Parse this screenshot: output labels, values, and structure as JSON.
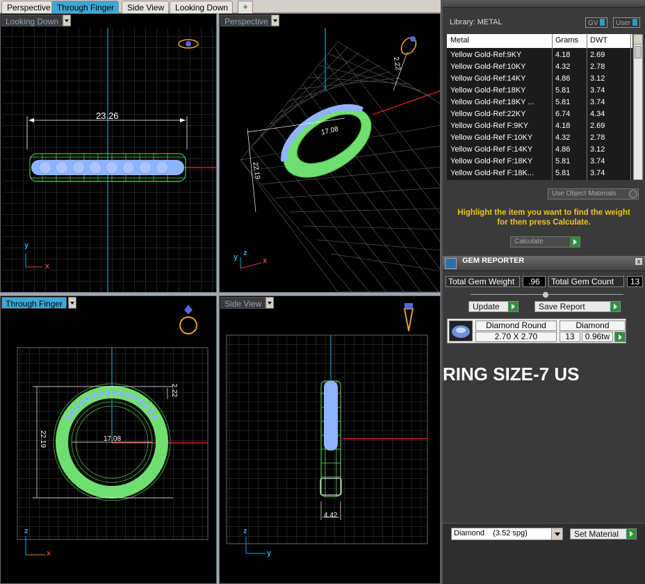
{
  "tabs": [
    {
      "label": "Perspective",
      "active": false
    },
    {
      "label": "Through Finger",
      "active": true
    },
    {
      "label": "Side View",
      "active": false
    },
    {
      "label": "Looking Down",
      "active": false
    }
  ],
  "tab_plus": "+",
  "viewports": {
    "top_left": {
      "label": "Looking Down",
      "dimension": "23.26",
      "axis_x": "x",
      "axis_y": "y"
    },
    "top_right": {
      "label": "Perspective",
      "dim_a": "17.08",
      "dim_b": "22.19",
      "dim_c": "2.22",
      "axis_x": "x",
      "axis_y": "y",
      "axis_z": "z"
    },
    "bottom_left": {
      "label": "Through Finger",
      "dim_width": "17.08",
      "dim_height": "22.19",
      "dim_thickness": "2.22",
      "axis_x": "x",
      "axis_y": "z"
    },
    "bottom_right": {
      "label": "Side View",
      "dim_width": "4.42",
      "axis_x": "y",
      "axis_y": "z"
    }
  },
  "metal_panel": {
    "library_label": "Library: METAL",
    "toggle_gv": "GV",
    "toggle_user": "User",
    "columns": [
      "Metal",
      "Grams",
      "DWT"
    ],
    "rows": [
      [
        "Yellow Gold-Ref:9KY",
        "4.18",
        "2.69"
      ],
      [
        "Yellow Gold-Ref:10KY",
        "4.32",
        "2.78"
      ],
      [
        "Yellow Gold-Ref:14KY",
        "4.86",
        "3.12"
      ],
      [
        "Yellow Gold-Ref:18KY",
        "5.81",
        "3.74"
      ],
      [
        "Yellow Gold-Ref:18KY ...",
        "5.81",
        "3.74"
      ],
      [
        "Yellow Gold-Ref:22KY",
        "6.74",
        "4.34"
      ],
      [
        "Yellow Gold-Ref F:9KY",
        "4.18",
        "2.69"
      ],
      [
        "Yellow Gold-Ref F:10KY",
        "4.32",
        "2.78"
      ],
      [
        "Yellow Gold-Ref F:14KY",
        "4.86",
        "3.12"
      ],
      [
        "Yellow Gold-Ref F:18KY",
        "5.81",
        "3.74"
      ],
      [
        "Yellow Gold-Ref F:18K...",
        "5.81",
        "3.74"
      ]
    ],
    "use_object_materials": "Use Object Materials",
    "hint_line1": "Highlight the item you want to find the weight",
    "hint_line2": "for then press Calculate.",
    "calculate_label": "Calculate"
  },
  "gem_reporter": {
    "title": "GEM REPORTER",
    "total_weight_label": "Total Gem Weight",
    "total_weight_value": ".96",
    "total_count_label": "Total Gem Count",
    "total_count_value": "13",
    "update_label": "Update",
    "save_report_label": "Save Report",
    "gem": {
      "shape": "Diamond Round",
      "size": "2.70 X 2.70",
      "material": "Diamond",
      "count": "13",
      "weight": "0.96tw"
    }
  },
  "ring_size": "RING SIZE-7 US",
  "material_select": {
    "value": "Diamond",
    "spg": "(3.52 spg)"
  },
  "set_material_label": "Set Material"
}
